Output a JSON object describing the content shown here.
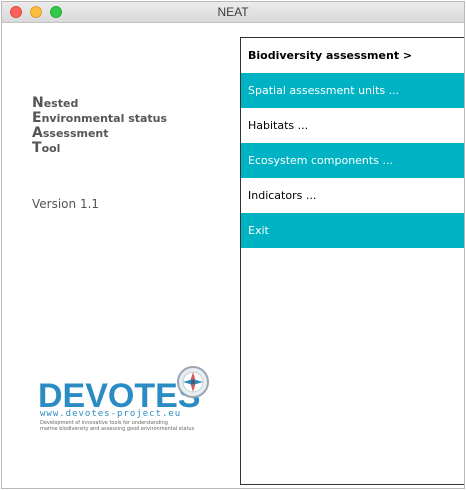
{
  "window": {
    "title": "NEAT"
  },
  "app": {
    "title_lines": [
      {
        "initial": "N",
        "rest": "ested"
      },
      {
        "initial": "E",
        "rest": "nvironmental status"
      },
      {
        "initial": "A",
        "rest": "ssessment"
      },
      {
        "initial": "T",
        "rest": "ool"
      }
    ],
    "version": "Version 1.1"
  },
  "menu": {
    "items": [
      {
        "label": "Biodiversity assessment >",
        "highlight": false
      },
      {
        "label": "Spatial assessment units ...",
        "highlight": true
      },
      {
        "label": "Habitats ...",
        "highlight": false
      },
      {
        "label": "Ecosystem components ...",
        "highlight": true
      },
      {
        "label": "Indicators ...",
        "highlight": false
      },
      {
        "label": "Exit",
        "highlight": true
      }
    ]
  },
  "logo": {
    "word": "DEVOTES",
    "url": "www.devotes-project.eu",
    "tagline_1": "Development of innovative tools for understanding",
    "tagline_2": "marine biodiversity and assessing good environmental status",
    "icon": "compass-icon"
  },
  "colors": {
    "teal": "#00b3c4",
    "brand_blue": "#2b8cc4"
  }
}
